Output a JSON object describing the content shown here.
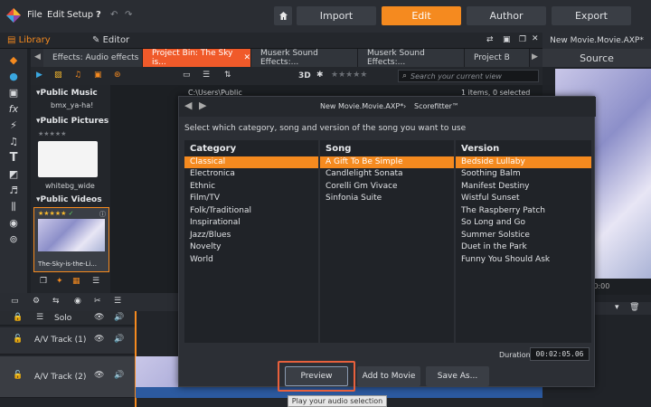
{
  "menu": {
    "file": "File",
    "edit": "Edit",
    "setup": "Setup"
  },
  "modes": {
    "import": "Import",
    "edit": "Edit",
    "author": "Author",
    "export": "Export"
  },
  "library": {
    "library_label": "Library",
    "editor_label": "Editor",
    "project_title": "New Movie.Movie.AXP*"
  },
  "tabs": [
    {
      "label": "Effects: Audio effects"
    },
    {
      "label": "Project Bin: The Sky is..."
    },
    {
      "label": "Muserk Sound Effects:..."
    },
    {
      "label": "Muserk Sound Effects:..."
    },
    {
      "label": "Project B"
    }
  ],
  "toolbar": {
    "three_d": "3D",
    "search_placeholder": "Search your current view"
  },
  "path": "C:\\Users\\Public",
  "selection_count": "1 items, 0 selected",
  "tree": {
    "public_music": "Public Music",
    "music_file": "bmx_ya-ha!",
    "public_pictures": "Public Pictures",
    "picture_file": "whitebg_wide",
    "public_videos": "Public Videos",
    "video_file": "The-Sky-is-the-Li..."
  },
  "source_label": "Source",
  "timeline": {
    "solo": "Solo",
    "track1": "A/V Track (1)",
    "track2": "A/V Track (2)"
  },
  "dialog": {
    "title_project": "New Movie.Movie.AXP*",
    "title_tool": "Scorefitter™",
    "instruction": "Select which category, song and version of the song you want to use",
    "category_header": "Category",
    "song_header": "Song",
    "version_header": "Version",
    "categories": [
      "Classical",
      "Electronica",
      "Ethnic",
      "Film/TV",
      "Folk/Traditional",
      "Inspirational",
      "Jazz/Blues",
      "Novelty",
      "World"
    ],
    "songs": [
      "A Gift To Be Simple",
      "Candlelight Sonata",
      "Corelli Gm Vivace",
      "Sinfonia Suite"
    ],
    "versions": [
      "Bedside Lullaby",
      "Soothing Balm",
      "Manifest Destiny",
      "Wistful Sunset",
      "The Raspberry Patch",
      "So Long and Go",
      "Summer Solstice",
      "Duet in the Park",
      "Funny You Should Ask"
    ],
    "duration_label": "Duration",
    "duration_value": "00:02:05.06",
    "preview": "Preview",
    "add_to_movie": "Add to Movie",
    "save_as": "Save As..."
  },
  "tooltip": "Play your audio selection",
  "colors": {
    "accent": "#f58a1f",
    "tab_active": "#f05a2a",
    "highlight_box": "#e8603c"
  }
}
